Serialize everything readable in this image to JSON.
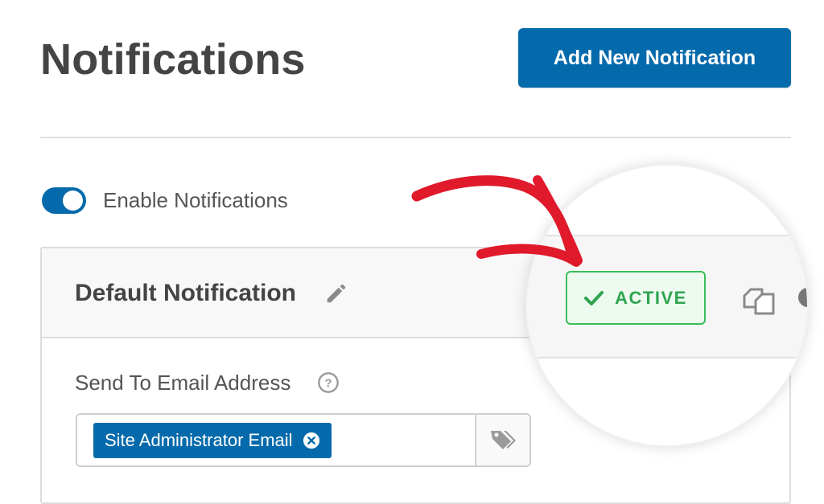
{
  "page": {
    "title": "Notifications",
    "add_button_label": "Add New Notification"
  },
  "toggle": {
    "label": "Enable Notifications",
    "enabled": true
  },
  "notification": {
    "title": "Default Notification",
    "status": "ACTIVE",
    "send_to_label": "Send To Email Address",
    "recipient_tag": "Site Administrator Email"
  },
  "icons": {
    "edit": "pencil-icon",
    "help": "help-circle-icon",
    "tag_remove": "close-circle-icon",
    "smart_tags": "tags-icon",
    "status_check": "check-icon",
    "duplicate": "duplicate-icon",
    "annotation_arrow": "red-arrow"
  },
  "colors": {
    "primary": "#056aab",
    "active_green": "#2ea44f",
    "arrow_red": "#e0192b"
  }
}
